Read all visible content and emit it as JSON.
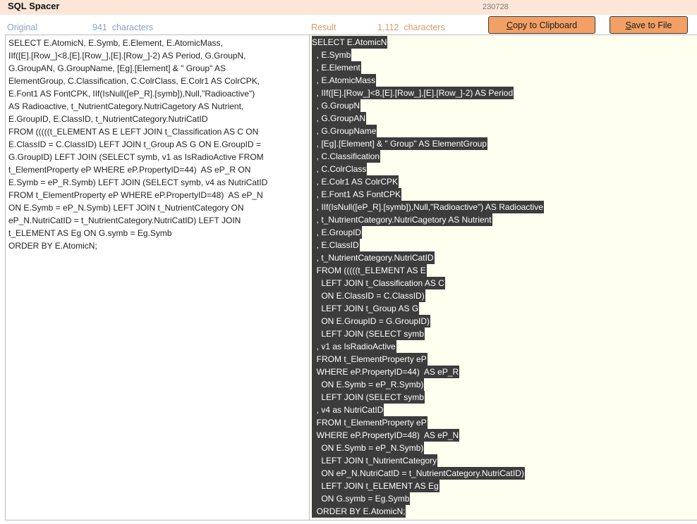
{
  "header": {
    "app_title": "SQL Spacer",
    "version": "230728"
  },
  "original": {
    "label": "Original",
    "count": "941",
    "count_suffix": "characters",
    "lines": [
      "SELECT E.AtomicN, E.Symb, E.Element, E.AtomicMass,",
      "IIf([E].[Row_]<8,[E].[Row_],[E].[Row_]-2) AS Period, G.GroupN,",
      "G.GroupAN, G.GroupName, [Eg].[Element] & \" Group\" AS",
      "ElementGroup, C.Classification, C.ColrClass, E.Colr1 AS ColrCPK,",
      "E.Font1 AS FontCPK, IIf(IsNull([eP_R].[symb]),Null,\"Radioactive\")",
      "AS Radioactive, t_NutrientCategory.NutriCagetory AS Nutrient,",
      "E.GroupID, E.ClassID, t_NutrientCategory.NutriCatID",
      "FROM (((((t_ELEMENT AS E LEFT JOIN t_Classification AS C ON",
      "E.ClassID = C.ClassID) LEFT JOIN t_Group AS G ON E.GroupID =",
      "G.GroupID) LEFT JOIN (SELECT symb, v1 as IsRadioActive FROM",
      "t_ElementProperty eP WHERE eP.PropertyID=44)  AS eP_R ON",
      "E.Symb = eP_R.Symb) LEFT JOIN (SELECT symb, v4 as NutriCatID",
      "FROM t_ElementProperty eP WHERE eP.PropertyID=48)  AS eP_N",
      "ON E.Symb = eP_N.Symb) LEFT JOIN t_NutrientCategory ON",
      "eP_N.NutriCatID = t_NutrientCategory.NutriCatID) LEFT JOIN",
      "t_ELEMENT AS Eg ON G.symb = Eg.Symb",
      "ORDER BY E.AtomicN;"
    ]
  },
  "result": {
    "label": "Result",
    "count": "1,112",
    "count_suffix": "characters",
    "lines": [
      "SELECT E.AtomicN",
      "  , E.Symb",
      "  , E.Element",
      "  , E.AtomicMass",
      "  , IIf([E].[Row_]<8,[E].[Row_],[E].[Row_]-2) AS Period",
      "  , G.GroupN",
      "  , G.GroupAN",
      "  , G.GroupName",
      "  , [Eg].[Element] & \" Group\" AS ElementGroup",
      "  , C.Classification",
      "  , C.ColrClass",
      "  , E.Colr1 AS ColrCPK",
      "  , E.Font1 AS FontCPK",
      "  , IIf(IsNull([eP_R].[symb]),Null,\"Radioactive\") AS Radioactive",
      "  , t_NutrientCategory.NutriCagetory AS Nutrient",
      "  , E.GroupID",
      "  , E.ClassID",
      "  , t_NutrientCategory.NutriCatID",
      "  FROM (((((t_ELEMENT AS E",
      "    LEFT JOIN t_Classification AS C",
      "    ON E.ClassID = C.ClassID)",
      "    LEFT JOIN t_Group AS G",
      "    ON E.GroupID = G.GroupID)",
      "    LEFT JOIN (SELECT symb",
      "  , v1 as IsRadioActive",
      "  FROM t_ElementProperty eP",
      "  WHERE eP.PropertyID=44)  AS eP_R",
      "    ON E.Symb = eP_R.Symb)",
      "    LEFT JOIN (SELECT symb",
      "  , v4 as NutriCatID",
      "  FROM t_ElementProperty eP",
      "  WHERE eP.PropertyID=48)  AS eP_N",
      "    ON E.Symb = eP_N.Symb)",
      "    LEFT JOIN t_NutrientCategory",
      "    ON eP_N.NutriCatID = t_NutrientCategory.NutriCatID)",
      "    LEFT JOIN t_ELEMENT AS Eg",
      "    ON G.symb = Eg.Symb",
      "  ORDER BY E.AtomicN;"
    ]
  },
  "buttons": {
    "copy": {
      "accel": "C",
      "rest": "opy to Clipboard"
    },
    "save": {
      "accel": "S",
      "rest": "ave to File"
    }
  },
  "colors": {
    "title_bar_bg": "#fbe6d8",
    "button_bg": "#f2a065",
    "original_label": "#8aa3bd",
    "result_label": "#d79a6c",
    "result_pane_bg": "#fffff0",
    "selection_bg": "#3c3c3c"
  }
}
